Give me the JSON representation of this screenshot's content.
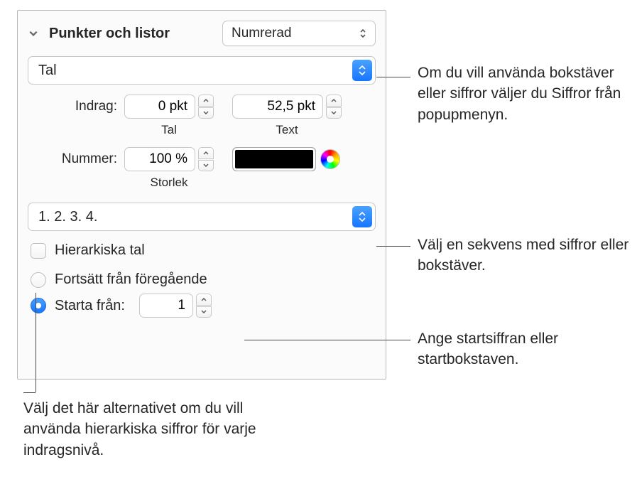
{
  "header": {
    "title": "Punkter och listor",
    "style_popup": "Numrerad"
  },
  "type_popup": "Tal",
  "indent": {
    "label": "Indrag:",
    "number_value": "0 pkt",
    "number_sub": "Tal",
    "text_value": "52,5 pkt",
    "text_sub": "Text"
  },
  "number_row": {
    "label": "Nummer:",
    "size_value": "100 %",
    "size_sub": "Storlek"
  },
  "sequence_popup": "1. 2. 3. 4.",
  "options": {
    "tiered": "Hierarkiska tal",
    "continue": "Fortsätt från föregående",
    "start_from": "Starta från:",
    "start_value": "1"
  },
  "callouts": {
    "c1": "Om du vill använda bokstäver eller siffror väljer du Siffror från popupmenyn.",
    "c2": "Välj en sekvens med siffror eller bokstäver.",
    "c3": "Ange startsiffran eller startbokstaven.",
    "c4": "Välj det här alternativet om du vill använda hierarkiska siffror för varje indragsnivå."
  }
}
